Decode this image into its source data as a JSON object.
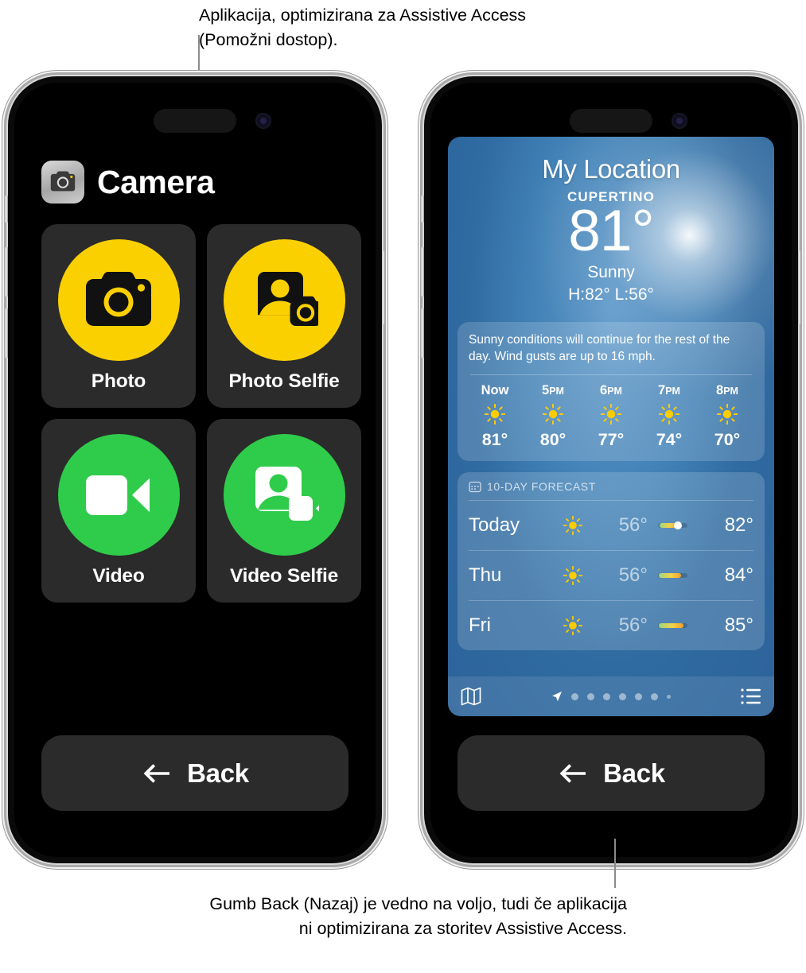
{
  "captions": {
    "top": "Aplikacija, optimizirana za Assistive Access (Pomožni dostop).",
    "bottom": "Gumb Back (Nazaj) je vedno na voljo, tudi če aplikacija ni optimizirana za storitev Assistive Access."
  },
  "camera_phone": {
    "app_title": "Camera",
    "app_icon": "camera-app-icon",
    "tiles": [
      {
        "label": "Photo",
        "icon": "camera-icon",
        "color": "#FBD000"
      },
      {
        "label": "Photo Selfie",
        "icon": "person-camera-icon",
        "color": "#FBD000"
      },
      {
        "label": "Video",
        "icon": "video-icon",
        "color": "#2FCC4B"
      },
      {
        "label": "Video Selfie",
        "icon": "person-video-icon",
        "color": "#2FCC4B"
      }
    ],
    "back_label": "Back"
  },
  "weather_phone": {
    "location": "My Location",
    "city": "CUPERTINO",
    "temperature": "81°",
    "condition": "Sunny",
    "high_low": "H:82°  L:56°",
    "summary": "Sunny conditions will continue for the rest of the day. Wind gusts are up to 16 mph.",
    "hourly": [
      {
        "time": "Now",
        "suffix": "",
        "icon": "sun-icon",
        "temp": "81°"
      },
      {
        "time": "5",
        "suffix": "PM",
        "icon": "sun-icon",
        "temp": "80°"
      },
      {
        "time": "6",
        "suffix": "PM",
        "icon": "sun-icon",
        "temp": "77°"
      },
      {
        "time": "7",
        "suffix": "PM",
        "icon": "sun-icon",
        "temp": "74°"
      },
      {
        "time": "8",
        "suffix": "PM",
        "icon": "sun-icon",
        "temp": "70°"
      }
    ],
    "daily_header": "10-DAY FORECAST",
    "daily_header_icon": "calendar-icon",
    "daily": [
      {
        "day": "Today",
        "icon": "sun-icon",
        "low": "56°",
        "high": "82°",
        "bar_start": 6,
        "bar_end": 67,
        "marker": 67
      },
      {
        "day": "Thu",
        "icon": "sun-icon",
        "low": "56°",
        "high": "84°",
        "bar_start": 3,
        "bar_end": 78,
        "marker": null
      },
      {
        "day": "Fri",
        "icon": "sun-icon",
        "low": "56°",
        "high": "85°",
        "bar_start": 3,
        "bar_end": 86,
        "marker": null
      }
    ],
    "toolbar": {
      "map_icon": "map-icon",
      "list_icon": "list-icon",
      "location_icon": "location-arrow-icon",
      "page_count": 7
    },
    "back_label": "Back"
  }
}
